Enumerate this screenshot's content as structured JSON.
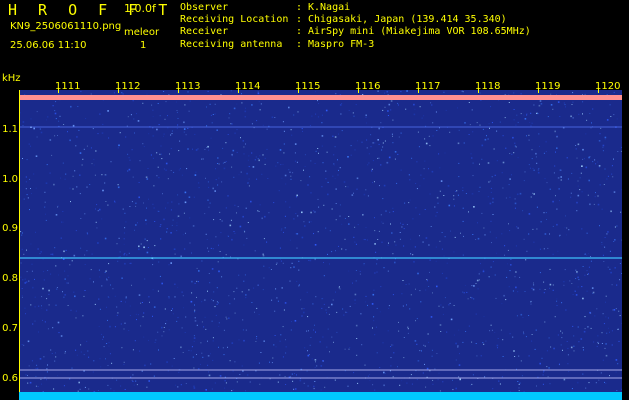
{
  "header": {
    "title": "H R O F F T",
    "version": "1.0.0f",
    "filename": "KN9_2506061110.png",
    "meteor_label": "meleor",
    "meteor_count": "1",
    "datetime": "25.06.06 11:10"
  },
  "info": [
    {
      "key": "Observer",
      "value": "K.Nagai"
    },
    {
      "key": "Receiving Location",
      "value": "Chigasaki, Japan (139.414 35.340)"
    },
    {
      "key": "Receiver",
      "value": "AirSpy mini (Miakejima VOR 108.65MHz)"
    },
    {
      "key": "Receiving antenna",
      "value": "Maspro FM-3"
    }
  ],
  "axes": {
    "y_unit": "kHz",
    "y_ticks": [
      "1.1",
      "1.0",
      "0.9",
      "0.8",
      "0.7",
      "0.6"
    ],
    "x_ticks": [
      "1111",
      "1112",
      "1113",
      "1114",
      "1115",
      "1116",
      "1117",
      "1118",
      "1119",
      "1120"
    ]
  },
  "colors": {
    "label": "#ffff00",
    "background": "#1a2a8c",
    "noise": "#3a7aff",
    "signal_top": "#ff9090",
    "signal_line": "#40c8ff"
  }
}
